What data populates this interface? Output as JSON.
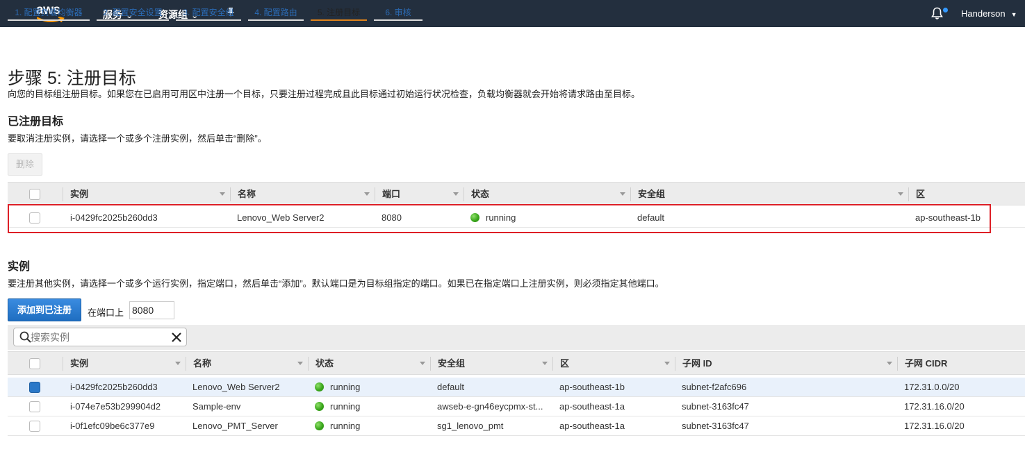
{
  "nav": {
    "logo_text": "aws",
    "services_label": "服务",
    "resource_groups_label": "资源组",
    "user_label": "Handerson"
  },
  "wizard": {
    "tabs": [
      {
        "label": "1. 配置负载均衡器",
        "active": false
      },
      {
        "label": "2. 配置安全设置",
        "active": false
      },
      {
        "label": "3. 配置安全组",
        "active": false
      },
      {
        "label": "4. 配置路由",
        "active": false
      },
      {
        "label": "5. 注册目标",
        "active": true
      },
      {
        "label": "6. 审核",
        "active": false
      }
    ]
  },
  "page": {
    "title": "步骤 5: 注册目标",
    "description": "向您的目标组注册目标。如果您在已启用可用区中注册一个目标，只要注册过程完成且此目标通过初始运行状况检查，负载均衡器就会开始将请求路由至目标。"
  },
  "registered": {
    "heading": "已注册目标",
    "description": "要取消注册实例，请选择一个或多个注册实例，然后单击“删除”。",
    "delete_label": "删除",
    "columns": [
      "实例",
      "名称",
      "端口",
      "状态",
      "安全组",
      "区"
    ],
    "rows": [
      {
        "instance": "i-0429fc2025b260dd3",
        "name": "Lenovo_Web Server2",
        "port": "8080",
        "status": "running",
        "security_group": "default",
        "zone": "ap-southeast-1b"
      }
    ]
  },
  "instances": {
    "heading": "实例",
    "description": "要注册其他实例，请选择一个或多个运行实例，指定端口，然后单击“添加”。默认端口是为目标组指定的端口。如果已在指定端口上注册实例，则必须指定其他端口。",
    "add_label": "添加到已注册",
    "port_label": "在端口上",
    "port_value": "8080",
    "search_placeholder": "搜索实例",
    "columns": [
      "实例",
      "名称",
      "状态",
      "安全组",
      "区",
      "子网 ID",
      "子网 CIDR"
    ],
    "rows": [
      {
        "instance": "i-0429fc2025b260dd3",
        "name": "Lenovo_Web Server2",
        "status": "running",
        "security_group": "default",
        "zone": "ap-southeast-1b",
        "subnet_id": "subnet-f2afc696",
        "subnet_cidr": "172.31.0.0/20",
        "selected": true
      },
      {
        "instance": "i-074e7e53b299904d2",
        "name": "Sample-env",
        "status": "running",
        "security_group": "awseb-e-gn46eycpmx-st...",
        "zone": "ap-southeast-1a",
        "subnet_id": "subnet-3163fc47",
        "subnet_cidr": "172.31.16.0/20",
        "selected": false
      },
      {
        "instance": "i-0f1efc09be6c377e9",
        "name": "Lenovo_PMT_Server",
        "status": "running",
        "security_group": "sg1_lenovo_pmt",
        "zone": "ap-southeast-1a",
        "subnet_id": "subnet-3163fc47",
        "subnet_cidr": "172.31.16.0/20",
        "selected": false
      }
    ]
  },
  "colors": {
    "nav_bg": "#232f3e",
    "accent_blue": "#2d7bd0",
    "active_tab_underline": "#e0831b",
    "highlight_border": "#dd1f26",
    "status_green": "#3aa61c"
  }
}
